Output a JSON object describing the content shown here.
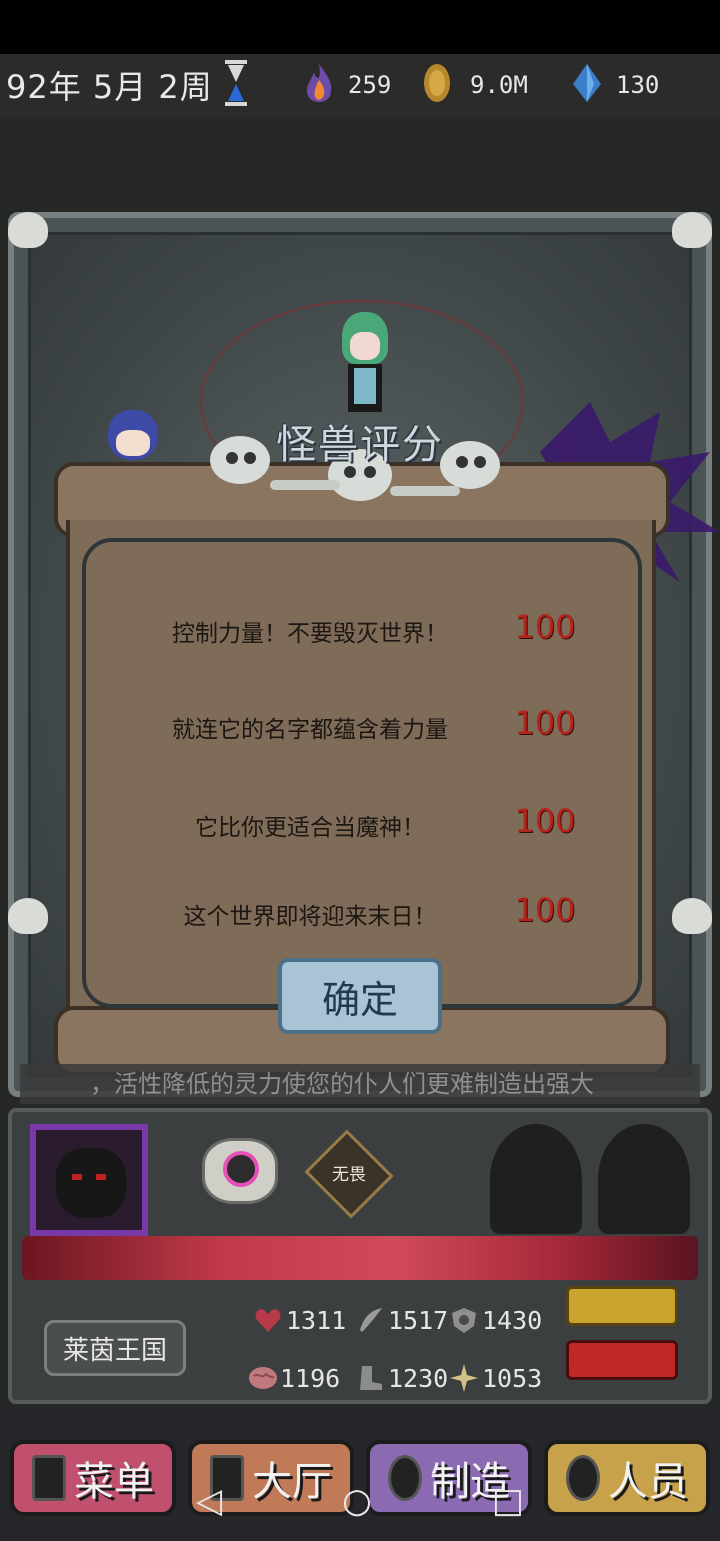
{
  "header": {
    "date": "92年 5月 2周",
    "resources": [
      {
        "icon": "flame-icon",
        "value": "259"
      },
      {
        "icon": "coin-icon",
        "value": "9.0M"
      },
      {
        "icon": "crystal-icon",
        "value": "130"
      }
    ]
  },
  "dialog": {
    "title": "怪兽评分",
    "rows": [
      {
        "label": "控制力量！不要毁灭世界！",
        "score": "100"
      },
      {
        "label": "就连它的名字都蕴含着力量",
        "score": "100"
      },
      {
        "label": "它比你更适合当魔神！",
        "score": "100"
      },
      {
        "label": "这个世界即将迎来末日！",
        "score": "100"
      }
    ],
    "confirm_label": "确定"
  },
  "ticker": {
    "text": "，活性降低的灵力使您的仆人们更难制造出强大"
  },
  "panel": {
    "fear_badge": "无畏",
    "kingdom": "莱茵王国",
    "stats_row1": [
      {
        "icon": "heart-icon",
        "value": "1311"
      },
      {
        "icon": "claw-icon",
        "value": "1517"
      },
      {
        "icon": "shield-icon",
        "value": "1430"
      }
    ],
    "stats_row2": [
      {
        "icon": "brain-icon",
        "value": "1196"
      },
      {
        "icon": "boot-icon",
        "value": "1230"
      },
      {
        "icon": "sparkle-icon",
        "value": "1053"
      }
    ]
  },
  "nav": {
    "items": [
      {
        "label": "菜单",
        "color": "#c0506e"
      },
      {
        "label": "大厅",
        "color": "#c07a58"
      },
      {
        "label": "制造",
        "color": "#8a6ab0"
      },
      {
        "label": "人员",
        "color": "#c8a24a"
      }
    ]
  },
  "system_nav": {
    "back": "◁",
    "home": "○",
    "recent": "□"
  }
}
